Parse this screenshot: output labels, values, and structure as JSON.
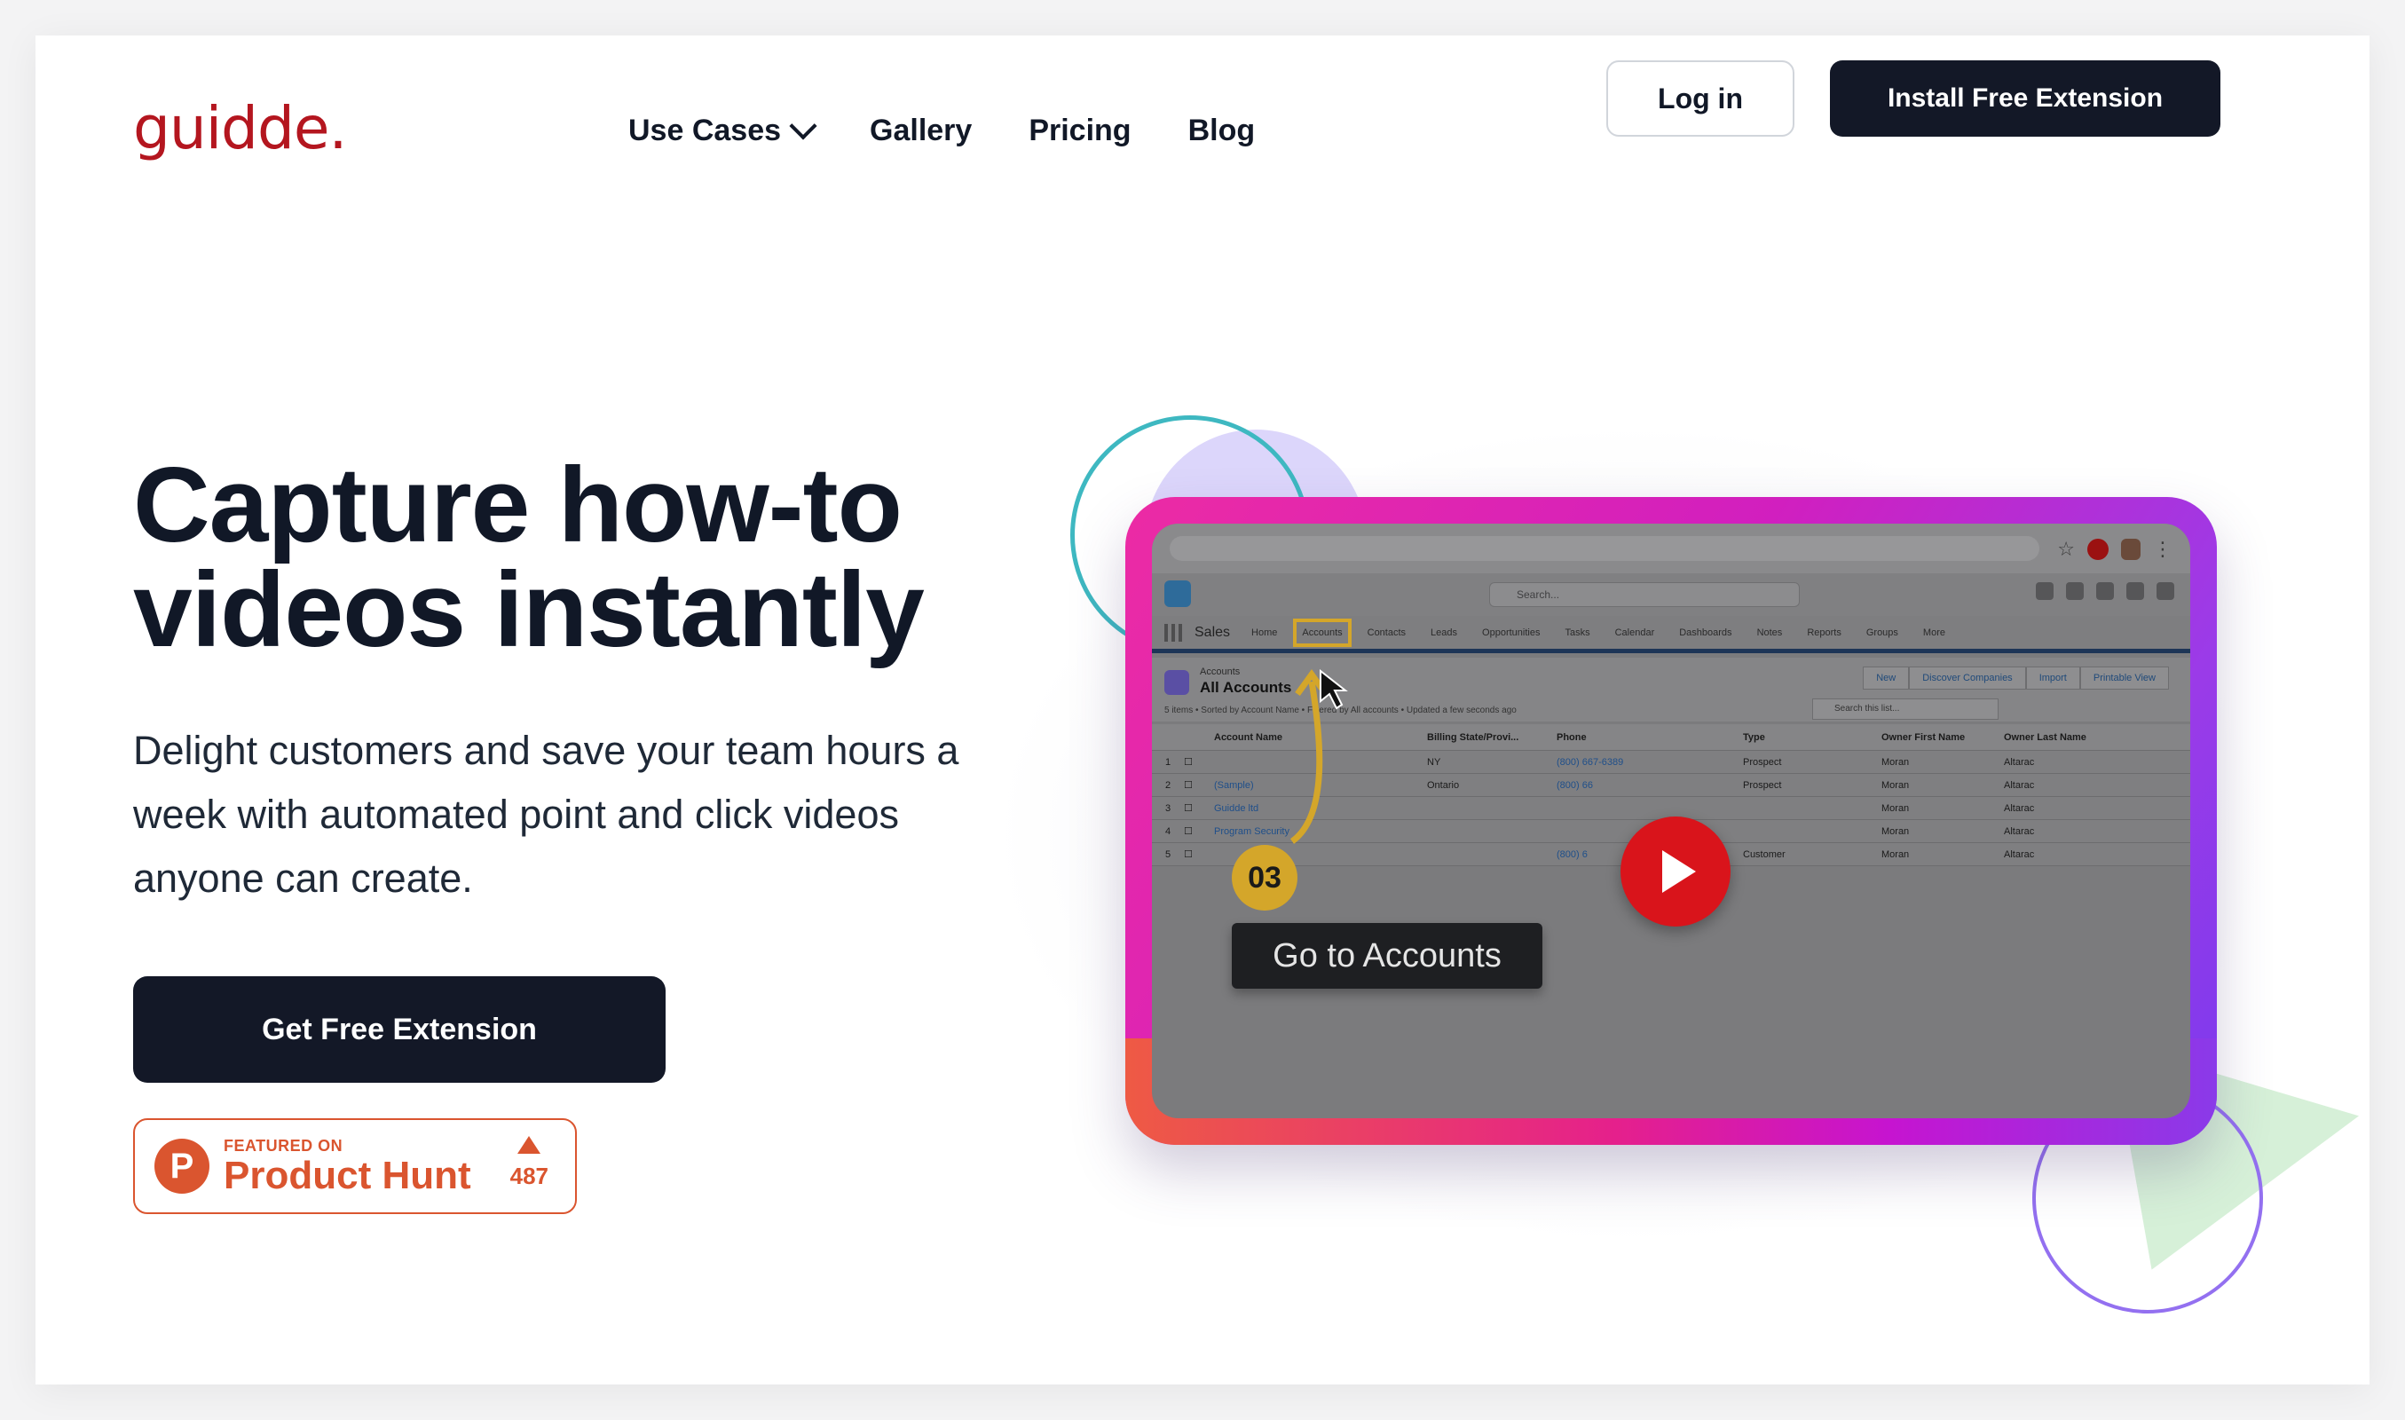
{
  "brand": {
    "logo": "guidde.",
    "logo_color": "#b4161f"
  },
  "nav": {
    "items": [
      {
        "label": "Use Cases",
        "has_dropdown": true
      },
      {
        "label": "Gallery"
      },
      {
        "label": "Pricing"
      },
      {
        "label": "Blog"
      }
    ],
    "login_label": "Log in",
    "install_label": "Install Free Extension"
  },
  "hero": {
    "headline_line1": "Capture how-to",
    "headline_line2": "videos instantly",
    "subhead": "Delight customers and save your team hours a week with automated point and click videos anyone can create.",
    "cta_label": "Get Free Extension"
  },
  "product_hunt": {
    "featured": "FEATURED ON",
    "name": "Product Hunt",
    "logo_letter": "P",
    "count": "487",
    "color": "#da552f"
  },
  "video": {
    "step_number": "03",
    "tooltip": "Go to Accounts",
    "screen": {
      "search_placeholder": "Search...",
      "app_name": "Sales",
      "tabs": [
        "Home",
        "Accounts",
        "Contacts",
        "Leads",
        "Opportunities",
        "Tasks",
        "Calendar",
        "Dashboards",
        "Notes",
        "Reports",
        "Groups",
        "More"
      ],
      "list_object": "Accounts",
      "list_view": "All Accounts",
      "list_meta": "5 items • Sorted by Account Name • Filtered by All accounts • Updated a few seconds ago",
      "buttons": [
        "New",
        "Discover Companies",
        "Import",
        "Printable View"
      ],
      "list_search_placeholder": "Search this list...",
      "columns": [
        "Account Name",
        "Billing State/Provi...",
        "Phone",
        "Type",
        "Owner First Name",
        "Owner Last Name"
      ],
      "rows": [
        {
          "num": "1",
          "name": "",
          "state": "NY",
          "phone": "(800) 667-6389",
          "type": "Prospect",
          "first": "Moran",
          "last": "Altarac"
        },
        {
          "num": "2",
          "name": "(Sample)",
          "state": "Ontario",
          "phone": "(800) 66",
          "type": "Prospect",
          "first": "Moran",
          "last": "Altarac"
        },
        {
          "num": "3",
          "name": "Guidde ltd",
          "state": "",
          "phone": "",
          "type": "",
          "first": "Moran",
          "last": "Altarac"
        },
        {
          "num": "4",
          "name": "Program Security",
          "state": "",
          "phone": "",
          "type": "",
          "first": "Moran",
          "last": "Altarac"
        },
        {
          "num": "5",
          "name": "",
          "state": "",
          "phone": "(800) 6",
          "type": "Customer",
          "first": "Moran",
          "last": "Altarac"
        }
      ]
    }
  },
  "colors": {
    "dark_button": "#131827",
    "frame_pink": "#ec2ba4",
    "frame_purple": "#7c3aed",
    "play_red": "#d9141b",
    "highlight_gold": "#d4a62a"
  }
}
